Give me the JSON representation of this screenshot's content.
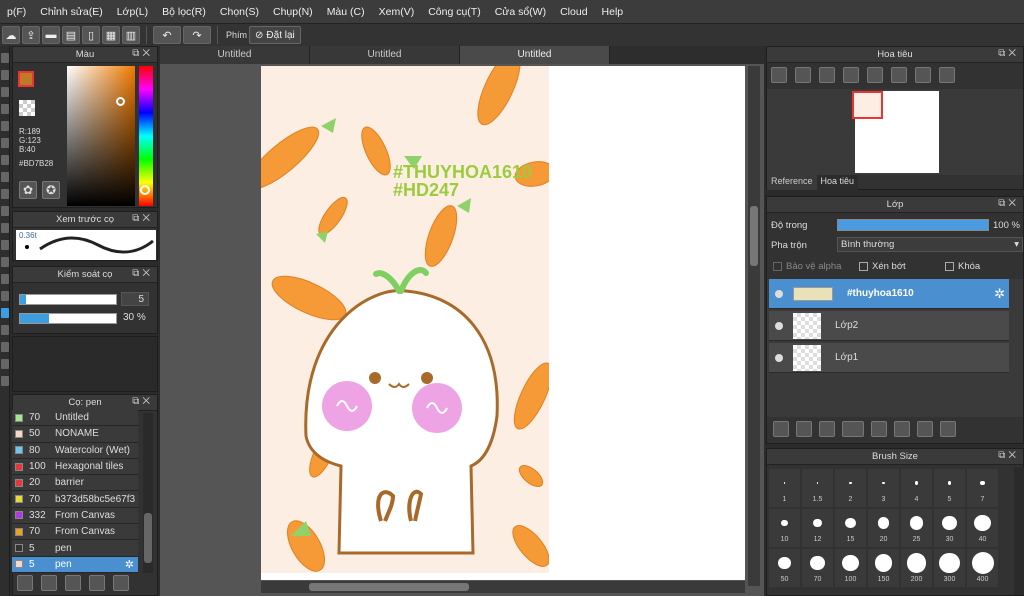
{
  "menu": [
    "p(F)",
    "Chỉnh sửa(E)",
    "Lớp(L)",
    "Bộ lọc(R)",
    "Chọn(S)",
    "Chụp(N)",
    "Màu (C)",
    "Xem(V)",
    "Công cụ(T)",
    "Cửa sổ(W)",
    "Cloud",
    "Help"
  ],
  "toolbar": {
    "key_label": "Phím",
    "reset_label": "Đặt lại"
  },
  "color_panel": {
    "title": "Màu",
    "r": "R:189",
    "g": "G:123",
    "b": "B:40",
    "hex": "#BD7B28",
    "main_color": "#BD7B28"
  },
  "brush_preview": {
    "title": "Xem trước cọ",
    "size": "0.36t"
  },
  "brush_control": {
    "title": "Kiểm soát cọ",
    "size": "5",
    "opacity": "30 %",
    "opacity_level": 0.3
  },
  "brushes": {
    "title": "Cọ: pen",
    "items": [
      {
        "num": "70",
        "name": "Untitled",
        "color": "#a8e68a"
      },
      {
        "num": "50",
        "name": "NONAME",
        "color": "#f5d9c6"
      },
      {
        "num": "80",
        "name": "Watercolor (Wet)",
        "color": "#6ac8f0"
      },
      {
        "num": "100",
        "name": "Hexagonal tiles",
        "color": "#e03a3a"
      },
      {
        "num": "20",
        "name": "barrier",
        "color": "#e03a3a"
      },
      {
        "num": "70",
        "name": "b373d58bc5e67f3",
        "color": "#e8d83a"
      },
      {
        "num": "332",
        "name": "From Canvas",
        "color": "#b03ae0"
      },
      {
        "num": "70",
        "name": "From Canvas",
        "color": "#f0a020"
      },
      {
        "num": "5",
        "name": "pen",
        "color": "#333333"
      },
      {
        "num": "5",
        "name": "pen",
        "color": "#f5d9c6"
      }
    ]
  },
  "tabs": [
    "Untitled",
    "Untitled",
    "Untitled"
  ],
  "artwork": {
    "watermark1": "#THUYHOA1610",
    "watermark2": "#HD247"
  },
  "navigator": {
    "title": "Hoa tiêu",
    "tab_reference": "Reference",
    "tab_navigator": "Hoa tiêu"
  },
  "layers": {
    "title": "Lớp",
    "opacity_label": "Độ trong",
    "opacity_value": "100 %",
    "opacity_level": 1.0,
    "blend_label": "Pha trộn",
    "blend_value": "Bình thường",
    "protect_alpha": "Bảo vệ alpha",
    "clipping": "Xén bớt",
    "lock": "Khóa",
    "items": [
      {
        "name": "#thuyhoa1610"
      },
      {
        "name": "Lớp2"
      },
      {
        "name": "Lớp1"
      }
    ]
  },
  "brush_size": {
    "title": "Brush Size",
    "sizes": [
      "1",
      "1.5",
      "2",
      "3",
      "4",
      "5",
      "7",
      "10",
      "12",
      "15",
      "20",
      "25",
      "30",
      "40",
      "50",
      "70",
      "100",
      "150",
      "200",
      "300",
      "400"
    ]
  }
}
